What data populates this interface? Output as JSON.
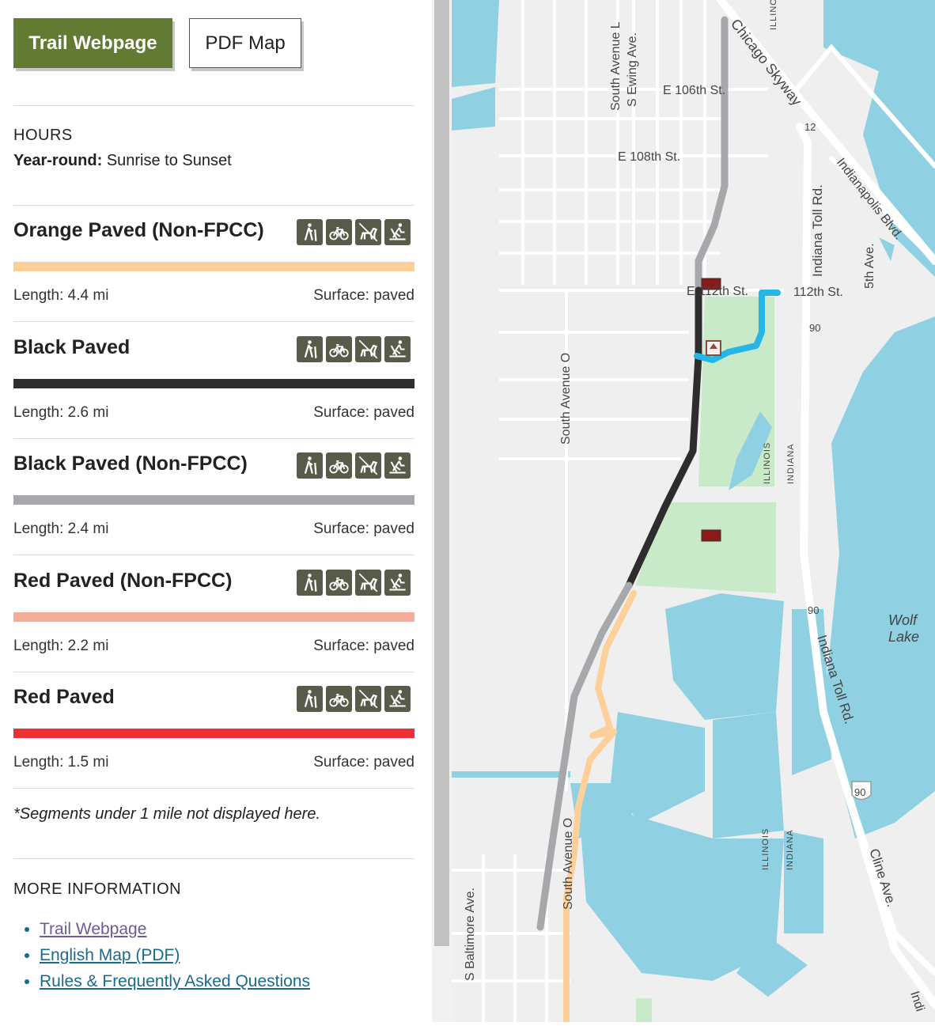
{
  "buttons": {
    "trail_webpage": "Trail Webpage",
    "pdf_map": "PDF Map"
  },
  "hours": {
    "title": "HOURS",
    "season": "Year-round:",
    "time": "Sunrise to Sunset"
  },
  "segments": [
    {
      "name": "Orange Paved (Non-FPCC)",
      "color": "#fdd09a",
      "length": "Length: 4.4 mi",
      "surface": "Surface: paved"
    },
    {
      "name": "Black Paved",
      "color": "#2d2d2d",
      "length": "Length: 2.6 mi",
      "surface": "Surface: paved"
    },
    {
      "name": "Black Paved (Non-FPCC)",
      "color": "#a7a8ab",
      "length": "Length: 2.4 mi",
      "surface": "Surface: paved"
    },
    {
      "name": "Red Paved (Non-FPCC)",
      "color": "#f5ad98",
      "length": "Length: 2.2 mi",
      "surface": "Surface: paved"
    },
    {
      "name": "Red Paved",
      "color": "#ec3034",
      "length": "Length: 1.5 mi",
      "surface": "Surface: paved"
    }
  ],
  "activity_icons": [
    "hiking-icon",
    "bicycle-icon",
    "dog-leash-icon",
    "cross-country-ski-icon"
  ],
  "note": "*Segments under 1 mile not displayed here.",
  "more_info": {
    "title": "MORE INFORMATION",
    "links": [
      "Trail Webpage",
      "English Map (PDF)",
      "Rules & Frequently Asked Questions"
    ]
  },
  "map": {
    "streets": {
      "e106": "E 106th St.",
      "e108": "E 108th St.",
      "e112": "E 112th St.",
      "s112": "112th St.",
      "south_ave_l": "South Avenue L",
      "s_ewing": "S Ewing Ave.",
      "south_ave_o": "South Avenue O",
      "south_ave_o_2": "South Avenue O",
      "s_baltimore": "S Baltimore Ave.",
      "chicago_skyway": "Chicago Skyway",
      "indianapolis_blvd": "Indianapolis Blvd.",
      "indiana_toll_rd": "Indiana Toll Rd.",
      "indiana_toll_rd_2": "Indiana Toll Rd.",
      "fifth_ave": "5th Ave.",
      "cline_ave": "Cline Ave.",
      "indi": "Indi"
    },
    "shields": {
      "r12": "12",
      "r90a": "90",
      "r90b": "90",
      "i90": "90"
    },
    "state_labels": {
      "illinois": "ILLINOIS",
      "indiana": "INDIANA"
    },
    "lake": [
      "Wolf",
      "Lake"
    ],
    "colors": {
      "water": "#8fd1e2",
      "park": "#c9eac9",
      "land": "#efefef",
      "road": "#ffffff"
    }
  }
}
